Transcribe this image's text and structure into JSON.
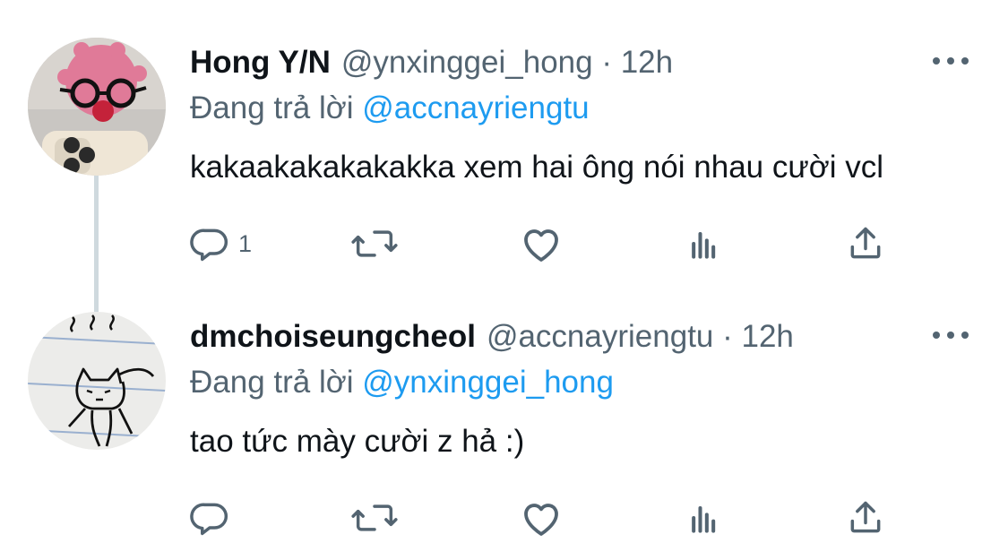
{
  "tweets": [
    {
      "display_name": "Hong Y/N",
      "handle_time": "@ynxinggei_hong · 12h",
      "reply_prefix": "Đang trả lời",
      "reply_mention": "@accnayriengtu",
      "text": "kakaakakakakakka xem hai ông nói nhau cười vcl",
      "reply_count": "1",
      "avatar": "pink-plush-with-glasses-avatar"
    },
    {
      "display_name": "dmchoiseungcheol",
      "handle_time": "@accnayriengtu · 12h",
      "reply_prefix": "Đang trả lời",
      "reply_mention": "@ynxinggei_hong",
      "text": "tao tức mày cười z hả :)",
      "reply_count": "",
      "avatar": "doodle-cat-avatar"
    }
  ],
  "icons": {
    "reply": "reply-icon",
    "retweet": "retweet-icon",
    "like": "heart-icon",
    "stats": "analytics-icon",
    "share": "share-icon",
    "more": "more-icon"
  },
  "colors": {
    "text": "#0f1419",
    "secondary": "#536471",
    "link": "#1d9bf0",
    "thread_line": "#cfd9de"
  }
}
